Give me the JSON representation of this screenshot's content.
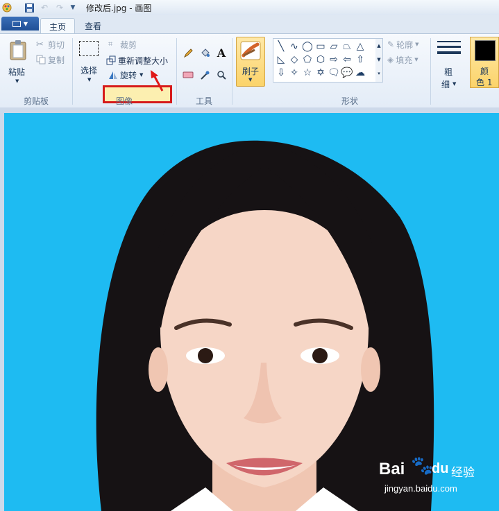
{
  "window": {
    "title": "修改后.jpg - 画图"
  },
  "tabs": [
    {
      "label": "主页",
      "active": true
    },
    {
      "label": "查看",
      "active": false
    }
  ],
  "clipboard": {
    "paste": "粘贴",
    "cut": "剪切",
    "copy": "复制",
    "group": "剪贴板"
  },
  "image": {
    "select": "选择",
    "crop": "裁剪",
    "resize": "重新调整大小",
    "rotate": "旋转",
    "group": "图像"
  },
  "tools": {
    "group": "工具"
  },
  "brushes": {
    "label": "刷子"
  },
  "shapes": {
    "outline": "轮廓",
    "fill": "填充",
    "group": "形状"
  },
  "size": {
    "label1": "粗",
    "label2": "细"
  },
  "color1": {
    "label1": "颜",
    "label2": "色 1"
  },
  "watermark": {
    "brand1": "Bai",
    "brand2": "du",
    "brand3": "经验",
    "url": "jingyan.baidu.com"
  },
  "colors": {
    "canvas_bg": "#1ebbf2",
    "highlight_border": "#d61a1a",
    "arrow": "#e01818"
  }
}
